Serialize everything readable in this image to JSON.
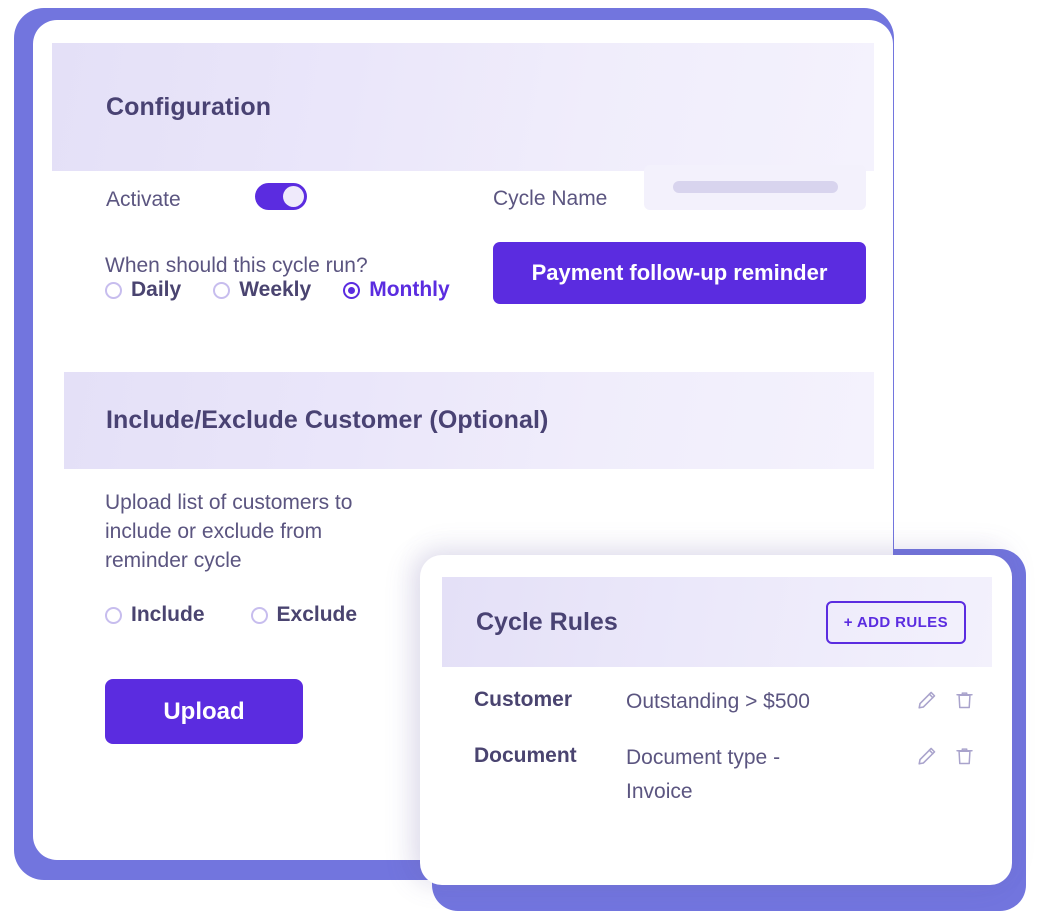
{
  "configuration": {
    "header_title": "Configuration",
    "activate_label": "Activate",
    "activate_state": "on",
    "cycle_name_label": "Cycle Name",
    "cycle_name_value": "",
    "frequency_question": "When should this cycle run?",
    "frequency_options": [
      {
        "label": "Daily",
        "selected": false
      },
      {
        "label": "Weekly",
        "selected": false
      },
      {
        "label": "Monthly",
        "selected": true
      }
    ],
    "reminder_button_label": "Payment follow-up reminder"
  },
  "include_exclude": {
    "header_title": "Include/Exclude Customer (Optional)",
    "description": "Upload list of customers to include or exclude from reminder cycle",
    "options": [
      {
        "label": "Include",
        "selected": false
      },
      {
        "label": "Exclude",
        "selected": false
      }
    ],
    "upload_button_label": "Upload"
  },
  "cycle_rules": {
    "header_title": "Cycle Rules",
    "add_button_label": "+ ADD RULES",
    "rows": [
      {
        "kind": "Customer",
        "description": "Outstanding > $500",
        "edit_icon": "pencil-icon",
        "delete_icon": "trash-icon"
      },
      {
        "kind": "Document",
        "description": "Document type - Invoice",
        "edit_icon": "pencil-icon",
        "delete_icon": "trash-icon"
      }
    ]
  },
  "colors": {
    "accent": "#5B2CE0",
    "backdrop": "#7275DE",
    "header_gradient_start": "#E4E0F7",
    "header_gradient_end": "#F4F2FD",
    "text_primary": "#494273",
    "text_secondary": "#5B5580",
    "radio_outline": "#C7BDEE"
  }
}
